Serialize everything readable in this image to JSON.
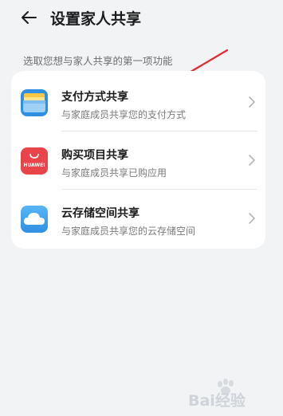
{
  "header": {
    "title": "设置家人共享",
    "back_icon": "arrow-left-icon"
  },
  "subtitle": "选取您想与家人共享的第一项功能",
  "items": [
    {
      "label": "支付方式共享",
      "desc": "与家庭成员共享您的支付方式",
      "icon": "wallet-icon"
    },
    {
      "label": "购买项目共享",
      "desc": "与家庭成员共享已购应用",
      "icon": "huawei-bag-icon",
      "icon_text": "HUAWEI"
    },
    {
      "label": "云存储空间共享",
      "desc": "与家庭成员共享您的云存储空间",
      "icon": "cloud-icon"
    }
  ],
  "watermark": {
    "text": "Bai经验"
  },
  "colors": {
    "background": "#f1f3f5",
    "card": "#ffffff",
    "arrow": "#e0282e",
    "huawei_red": "#e84449",
    "wallet_blue": "#2f8fe3"
  }
}
